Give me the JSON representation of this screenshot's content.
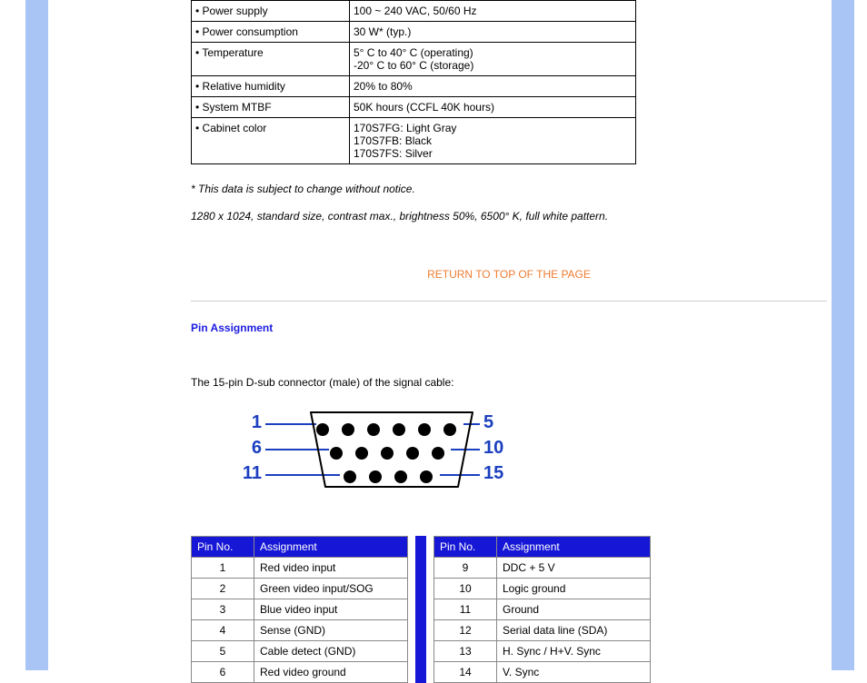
{
  "spec_table": {
    "rows": [
      {
        "label": "• Power supply",
        "value": "100 ~ 240 VAC, 50/60 Hz"
      },
      {
        "label": "• Power consumption",
        "value": "30 W* (typ.)"
      },
      {
        "label": "• Temperature",
        "value": "5° C to 40° C (operating)\n-20° C to 60° C (storage)"
      },
      {
        "label": "• Relative humidity",
        "value": "20% to 80%"
      },
      {
        "label": "• System MTBF",
        "value": "50K hours (CCFL 40K hours)"
      },
      {
        "label": "• Cabinet color",
        "value": "170S7FG: Light Gray\n170S7FB: Black\n170S7FS: Silver"
      }
    ]
  },
  "notice": "* This data is subject to change without notice.",
  "pattern_note": "1280 x 1024, standard size, contrast max., brightness 50%, 6500° K, full white pattern.",
  "return_top": "RETURN TO TOP OF THE PAGE",
  "pin_section_title": "Pin Assignment",
  "pin_desc": "The 15-pin D-sub connector (male) of the signal cable:",
  "connector_labels": {
    "l1": "1",
    "l2": "6",
    "l3": "11",
    "r1": "5",
    "r2": "10",
    "r3": "15"
  },
  "pin_headers": {
    "no": "Pin No.",
    "assign": "Assignment"
  },
  "pin_left": [
    {
      "no": "1",
      "assign": "Red video input"
    },
    {
      "no": "2",
      "assign": "Green video input/SOG"
    },
    {
      "no": "3",
      "assign": "Blue video input"
    },
    {
      "no": "4",
      "assign": "Sense (GND)"
    },
    {
      "no": "5",
      "assign": "Cable detect (GND)"
    },
    {
      "no": "6",
      "assign": "Red video ground"
    }
  ],
  "pin_right": [
    {
      "no": "9",
      "assign": "DDC + 5 V"
    },
    {
      "no": "10",
      "assign": "Logic ground"
    },
    {
      "no": "11",
      "assign": "Ground"
    },
    {
      "no": "12",
      "assign": "Serial data line (SDA)"
    },
    {
      "no": "13",
      "assign": "H. Sync / H+V. Sync"
    },
    {
      "no": "14",
      "assign": "V. Sync"
    }
  ]
}
